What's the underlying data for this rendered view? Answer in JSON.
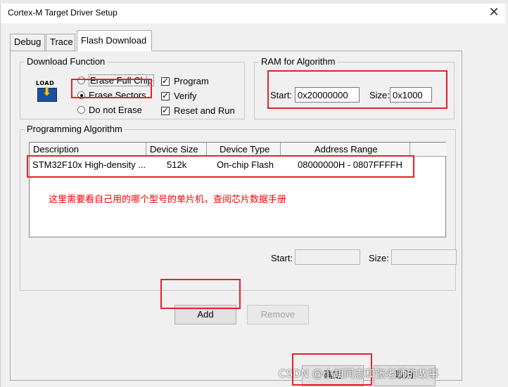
{
  "window": {
    "title": "Cortex-M Target Driver Setup",
    "close_glyph": "✕"
  },
  "tabs": [
    {
      "label": "Debug",
      "active": false
    },
    {
      "label": "Trace",
      "active": false
    },
    {
      "label": "Flash Download",
      "active": true
    }
  ],
  "download_function": {
    "label": "Download Function",
    "icon": "load-icon",
    "icon_text": "LOAD",
    "options": [
      {
        "label": "Erase Full Chip",
        "selected": false
      },
      {
        "label": "Erase Sectors",
        "selected": true
      },
      {
        "label": "Do not Erase",
        "selected": false
      }
    ],
    "checks": [
      {
        "label": "Program",
        "checked": true
      },
      {
        "label": "Verify",
        "checked": true
      },
      {
        "label": "Reset and Run",
        "checked": true
      }
    ]
  },
  "ram": {
    "label": "RAM for Algorithm",
    "start_label": "Start:",
    "start_value": "0x20000000",
    "size_label": "Size:",
    "size_value": "0x1000"
  },
  "programming_algorithm": {
    "label": "Programming Algorithm",
    "columns": [
      "Description",
      "Device Size",
      "Device Type",
      "Address Range"
    ],
    "rows": [
      {
        "description": "STM32F10x High-density ...",
        "size": "512k",
        "type": "On-chip Flash",
        "range": "08000000H - 0807FFFFH"
      }
    ],
    "annotation": "这里需要看自己用的哪个型号的单片机，查阅芯片数据手册",
    "start_label": "Start:",
    "size_label": "Size:"
  },
  "buttons": {
    "add": "Add",
    "remove": "Remove",
    "ok": "确定",
    "cancel": "取消"
  },
  "watermark": "CSDN @小胡同志和张老师的故事",
  "colors": {
    "highlight": "#e5202a",
    "annotation": "#ff0000",
    "dialog_bg": "#f0f0f0"
  }
}
